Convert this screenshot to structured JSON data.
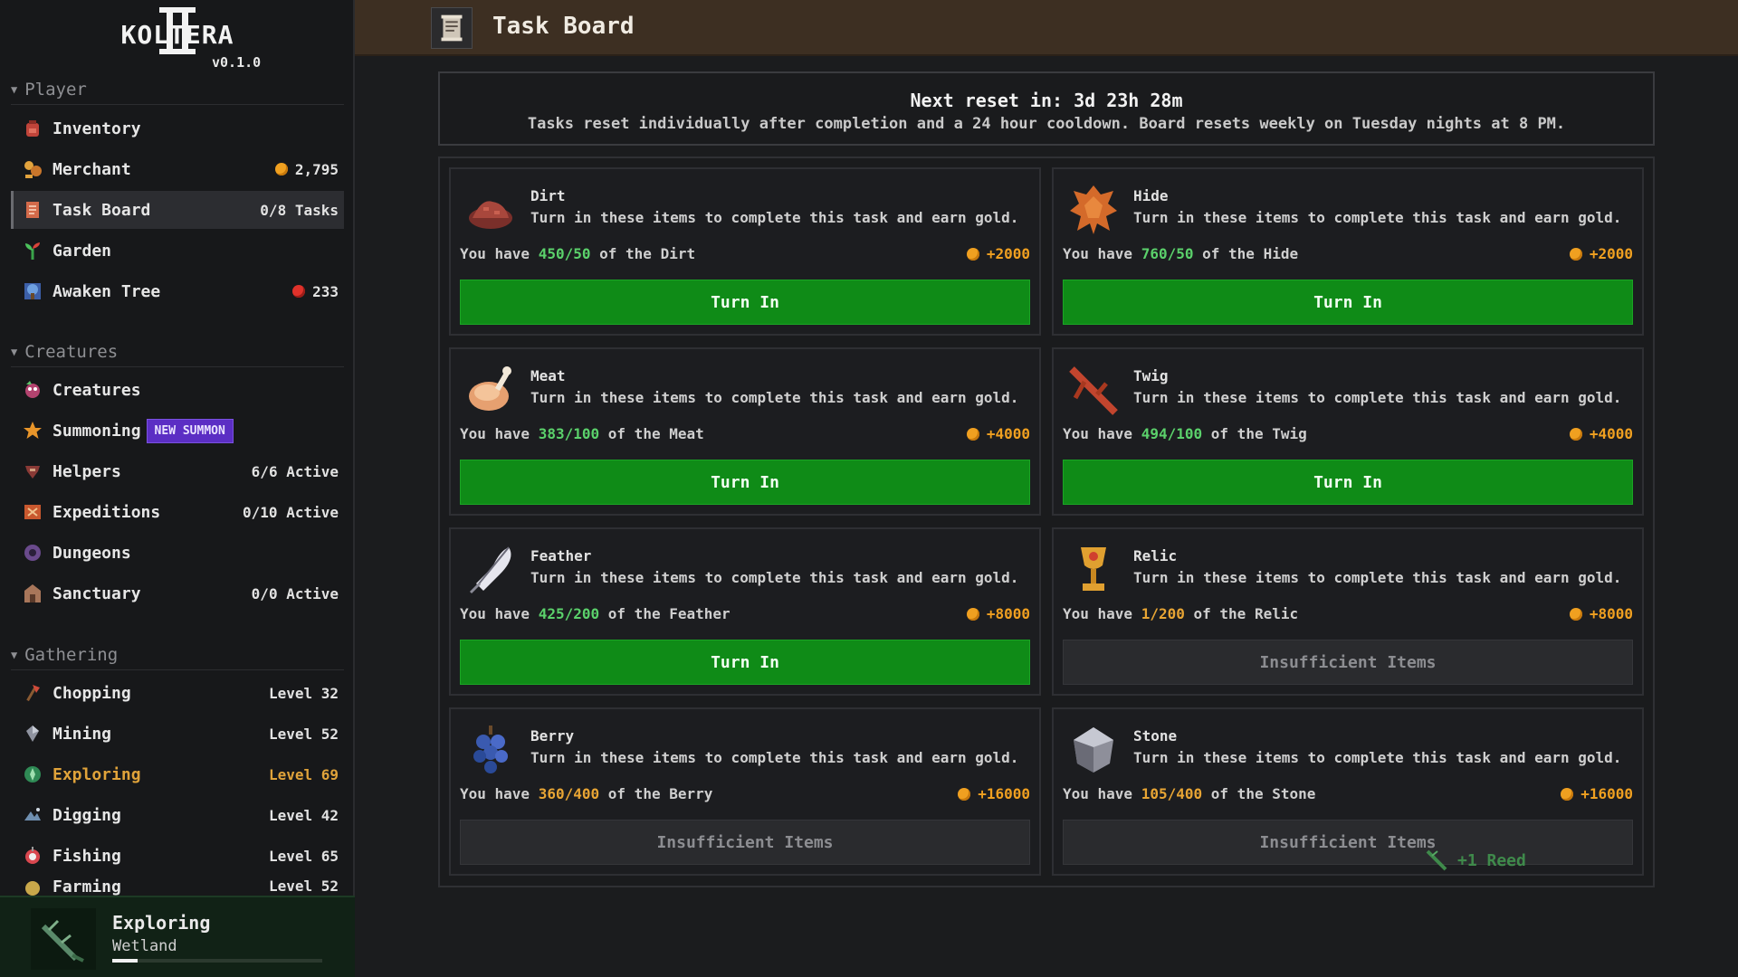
{
  "app": {
    "logo_text": "KOLTERA",
    "version": "v0.1.0"
  },
  "sidebar": {
    "sections": [
      {
        "title": "Player"
      },
      {
        "title": "Creatures"
      },
      {
        "title": "Gathering"
      }
    ],
    "player_items": [
      {
        "label": "Inventory",
        "right": ""
      },
      {
        "label": "Merchant",
        "right": "2,795"
      },
      {
        "label": "Task Board",
        "right": "0/8 Tasks"
      },
      {
        "label": "Garden",
        "right": ""
      },
      {
        "label": "Awaken Tree",
        "right": "233"
      }
    ],
    "creature_items": [
      {
        "label": "Creatures",
        "right": ""
      },
      {
        "label": "Summoning",
        "badge": "NEW SUMMON"
      },
      {
        "label": "Helpers",
        "right": "6/6 Active"
      },
      {
        "label": "Expeditions",
        "right": "0/10 Active"
      },
      {
        "label": "Dungeons",
        "right": ""
      },
      {
        "label": "Sanctuary",
        "right": "0/0 Active"
      }
    ],
    "gathering_items": [
      {
        "label": "Chopping",
        "right": "Level 32"
      },
      {
        "label": "Mining",
        "right": "Level 52"
      },
      {
        "label": "Exploring",
        "right": "Level 69"
      },
      {
        "label": "Digging",
        "right": "Level 42"
      },
      {
        "label": "Fishing",
        "right": "Level 65"
      },
      {
        "label": "Farming",
        "right": "Level 52"
      }
    ],
    "activity": {
      "title": "Exploring",
      "location": "Wetland",
      "progress": 0.12
    }
  },
  "header": {
    "title": "Task Board"
  },
  "reset": {
    "line1": "Next reset in: 3d 23h 28m",
    "line2": "Tasks reset individually after completion and a 24 hour cooldown. Board resets weekly on Tuesday nights at 8 PM."
  },
  "task_desc": "Turn in these items to complete this task and earn gold.",
  "tasks": [
    {
      "name": "Dirt",
      "have_prefix": "You have",
      "count": "450/50",
      "suffix": "of the Dirt",
      "reward": "+2000",
      "button": "Turn In",
      "ready": true
    },
    {
      "name": "Hide",
      "have_prefix": "You have",
      "count": "760/50",
      "suffix": "of the Hide",
      "reward": "+2000",
      "button": "Turn In",
      "ready": true
    },
    {
      "name": "Meat",
      "have_prefix": "You have",
      "count": "383/100",
      "suffix": "of the Meat",
      "reward": "+4000",
      "button": "Turn In",
      "ready": true
    },
    {
      "name": "Twig",
      "have_prefix": "You have",
      "count": "494/100",
      "suffix": "of the Twig",
      "reward": "+4000",
      "button": "Turn In",
      "ready": true
    },
    {
      "name": "Feather",
      "have_prefix": "You have",
      "count": "425/200",
      "suffix": "of the Feather",
      "reward": "+8000",
      "button": "Turn In",
      "ready": true
    },
    {
      "name": "Relic",
      "have_prefix": "You have",
      "count": "1/200",
      "suffix": "of the Relic",
      "reward": "+8000",
      "button": "Insufficient Items",
      "ready": false
    },
    {
      "name": "Berry",
      "have_prefix": "You have",
      "count": "360/400",
      "suffix": "of the Berry",
      "reward": "+16000",
      "button": "Insufficient Items",
      "ready": false
    },
    {
      "name": "Stone",
      "have_prefix": "You have",
      "count": "105/400",
      "suffix": "of the Stone",
      "reward": "+16000",
      "button": "Insufficient Items",
      "ready": false
    }
  ],
  "toast": {
    "text": "+1 Reed"
  }
}
